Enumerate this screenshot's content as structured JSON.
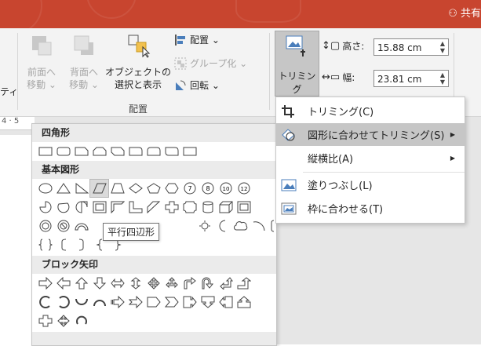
{
  "titlebar": {
    "share_label": "共有",
    "color": "#c8452f"
  },
  "ribbon": {
    "group_partial_label": "ティ",
    "bring_forward": {
      "line1": "前面へ",
      "line2": "移動 ⌄"
    },
    "send_backward": {
      "line1": "背面へ",
      "line2": "移動 ⌄"
    },
    "selection_pane": {
      "line1": "オブジェクトの",
      "line2": "選択と表示"
    },
    "align_label": "配置 ⌄",
    "group_label": "グループ化 ⌄",
    "rotate_label": "回転 ⌄",
    "arrange_group_label": "配置",
    "crop_label": "トリミング",
    "height_label": "高さ:",
    "height_value": "15.88 cm",
    "width_label": "幅:",
    "width_value": "23.81 cm"
  },
  "ruler": {
    "text": "4 · 5"
  },
  "crop_menu": {
    "items": [
      {
        "label": "トリミング(C)",
        "icon": "crop-icon"
      },
      {
        "label": "図形に合わせてトリミング(S)",
        "icon": "crop-to-shape-icon",
        "submenu": true,
        "highlighted": true
      },
      {
        "label": "縦横比(A)",
        "icon": "",
        "submenu": true
      },
      {
        "label": "塗りつぶし(L)",
        "icon": "fill-icon"
      },
      {
        "label": "枠に合わせる(T)",
        "icon": "fit-icon"
      }
    ]
  },
  "shapes_gallery": {
    "categories": [
      "四角形",
      "基本図形",
      "ブロック矢印"
    ],
    "tooltip": "平行四辺形",
    "selected_shape": "parallelogram"
  }
}
